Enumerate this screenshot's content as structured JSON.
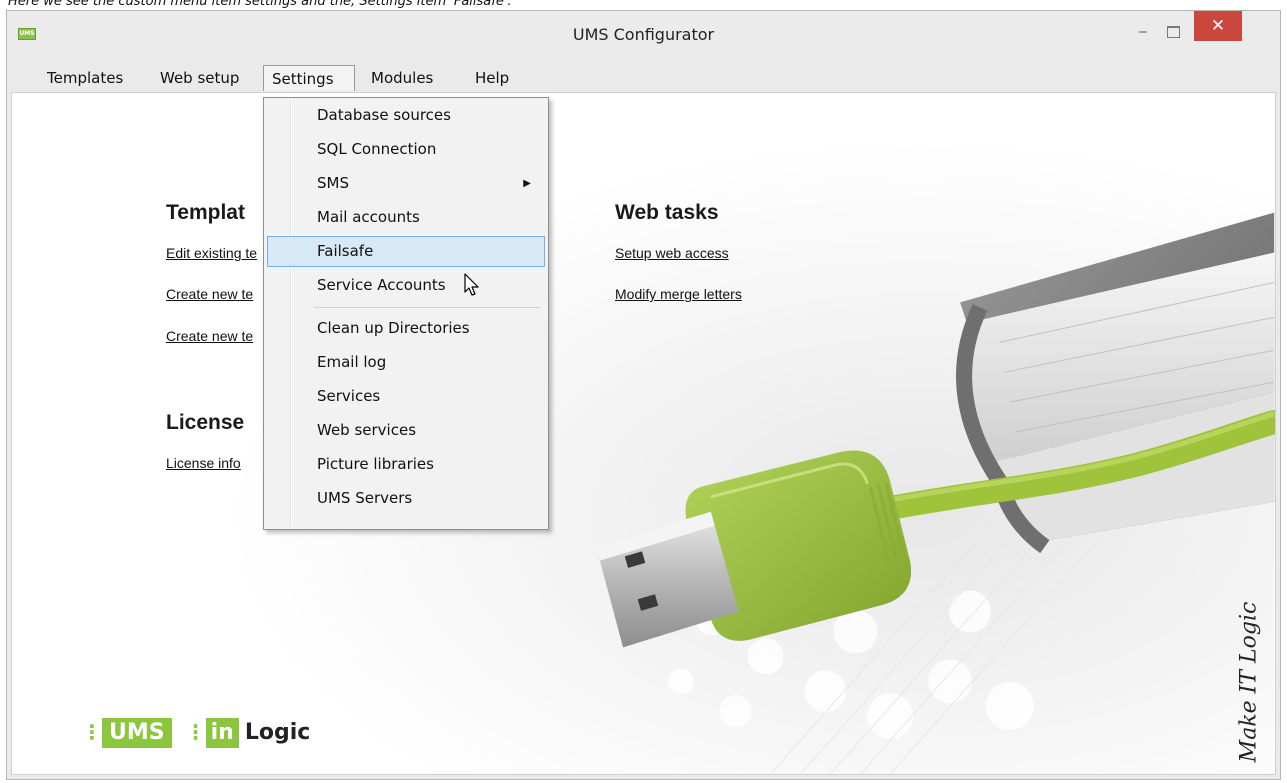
{
  "caption": "Here we see the custom menu item settings and the, Settings item 'Failsafe'.",
  "window": {
    "icon_text": "UMS",
    "title": "UMS Configurator",
    "minimize_glyph": "‒",
    "close_glyph": "✕"
  },
  "menubar": {
    "items": [
      "Templates",
      "Web setup",
      "Settings",
      "Modules",
      "Help"
    ],
    "active": "Settings"
  },
  "settings_menu": {
    "items": [
      "Database sources",
      "SQL Connection",
      "SMS",
      "Mail accounts",
      "Failsafe",
      "Service Accounts",
      "Clean up Directories",
      "Email log",
      "Services",
      "Web services",
      "Picture libraries",
      "UMS Servers"
    ],
    "highlighted": "Failsafe",
    "submenu_item": "SMS",
    "submenu_arrow": "▶"
  },
  "templates_section": {
    "heading": "Templat",
    "links": [
      "Edit existing te",
      "Create new te",
      "Create new te"
    ]
  },
  "license_section": {
    "heading": "License",
    "links": [
      "License info"
    ]
  },
  "web_tasks_section": {
    "heading": "Web tasks",
    "links": [
      "Setup web access",
      "Modify merge letters"
    ]
  },
  "branding": {
    "dots": "⋮",
    "ums": "UMS",
    "in": "in",
    "logic": "Logic",
    "tagline": "Make IT Logic",
    "accent_color": "#8cc63f"
  }
}
